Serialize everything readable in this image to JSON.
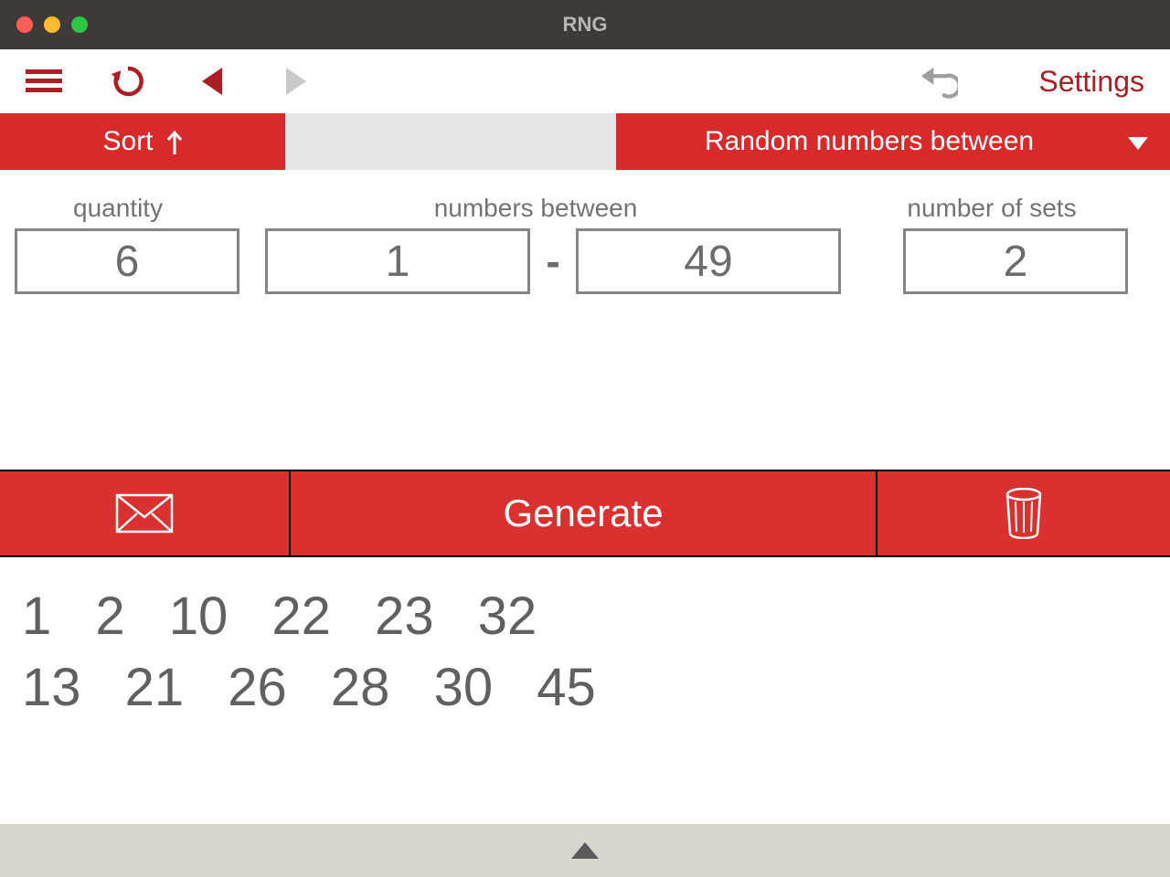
{
  "window": {
    "title": "RNG"
  },
  "toolbar": {
    "settings_label": "Settings"
  },
  "segbar": {
    "sort_label": "Sort",
    "mode_label": "Random numbers between"
  },
  "labels": {
    "quantity": "quantity",
    "between": "numbers between",
    "sets": "number of sets"
  },
  "inputs": {
    "quantity": "6",
    "min": "1",
    "max": "49",
    "sets": "2"
  },
  "generate": {
    "label": "Generate"
  },
  "results": {
    "sets": [
      [
        "1",
        "2",
        "10",
        "22",
        "23",
        "32"
      ],
      [
        "13",
        "21",
        "26",
        "28",
        "30",
        "45"
      ]
    ]
  },
  "colors": {
    "brand_red": "#d82a2a",
    "dark_red": "#ac1d24",
    "titlebar": "#3e3a38",
    "grey_text": "#6c6c6c"
  },
  "icons": {
    "menu": "menu-icon",
    "reload": "reload-icon",
    "back": "triangle-left-icon",
    "forward": "triangle-right-icon",
    "undo": "undo-icon",
    "sort_arrow": "arrow-up-icon",
    "mode_caret": "caret-down-icon",
    "mail": "mail-icon",
    "trash": "trash-icon",
    "pull_up": "triangle-up-icon"
  }
}
